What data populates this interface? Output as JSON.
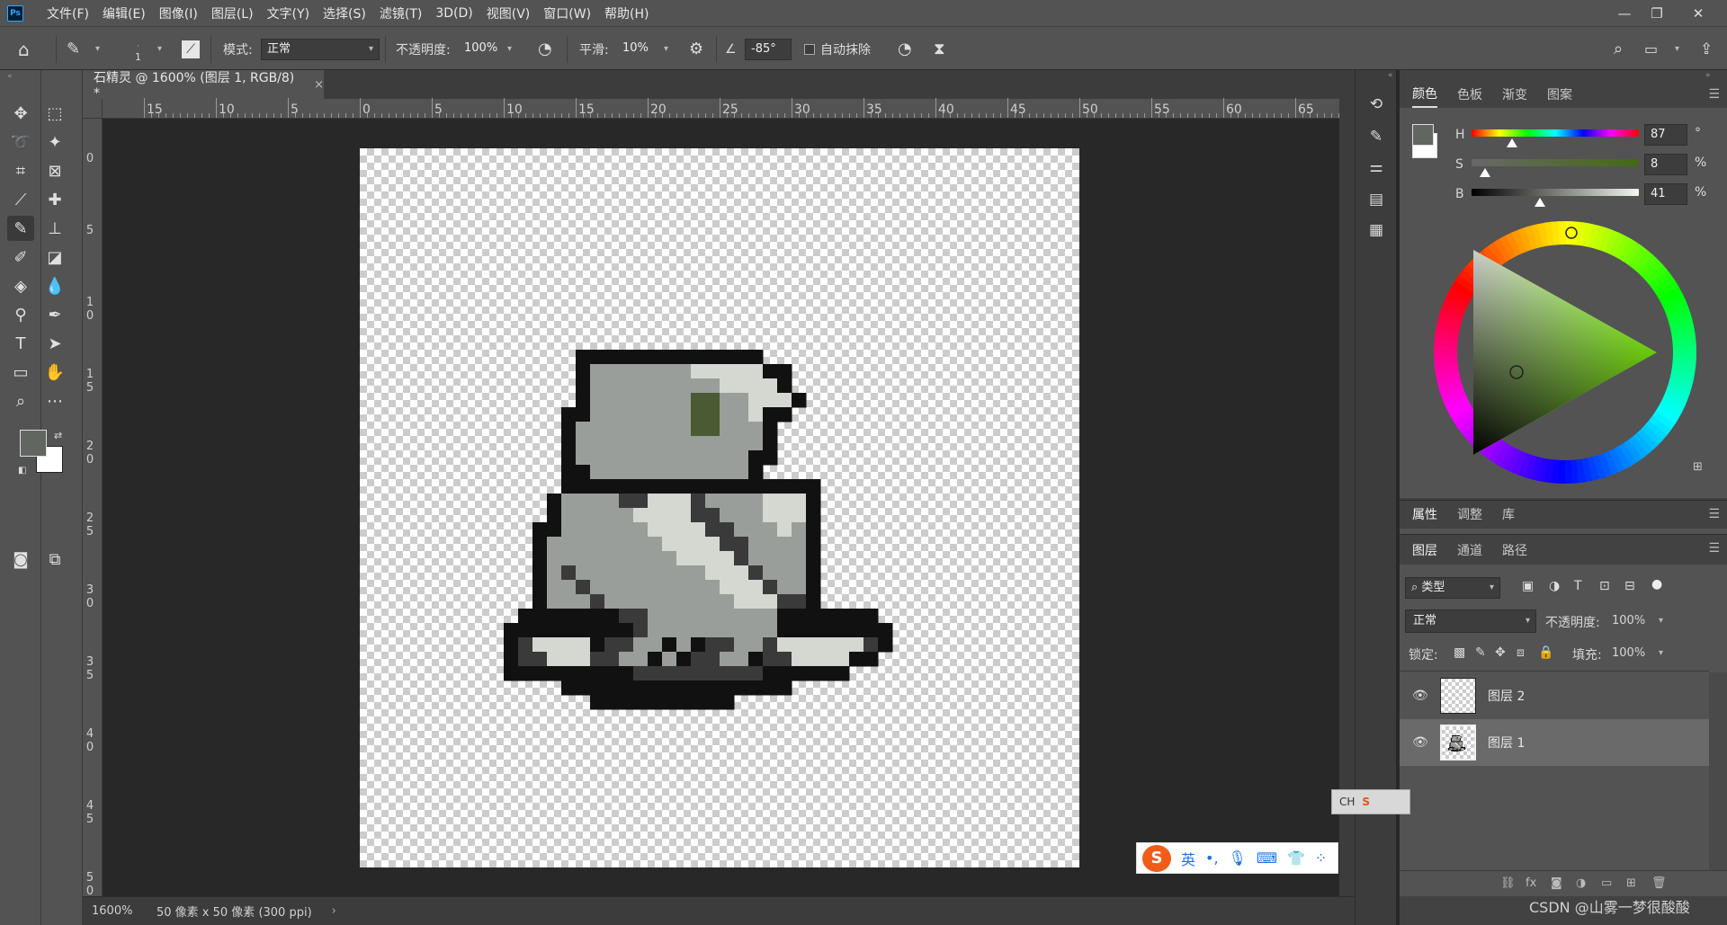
{
  "app": {
    "logo": "Ps"
  },
  "menu": [
    "文件(F)",
    "编辑(E)",
    "图像(I)",
    "图层(L)",
    "文字(Y)",
    "选择(S)",
    "滤镜(T)",
    "3D(D)",
    "视图(V)",
    "窗口(W)",
    "帮助(H)"
  ],
  "window_controls": {
    "minimize": "—",
    "restore": "❐",
    "close": "✕"
  },
  "options": {
    "brush_size": "1",
    "mode_label": "模式:",
    "mode_value": "正常",
    "opacity_label": "不透明度:",
    "opacity_value": "100%",
    "smoothing_label": "平滑:",
    "smoothing_value": "10%",
    "angle_value": "-85°",
    "auto_erase_label": "自动抹除"
  },
  "document": {
    "tab_title": "石精灵 @ 1600% (图层 1, RGB/8) *",
    "close_glyph": "×"
  },
  "ruler_top_labels": [
    "15",
    "10",
    "5",
    "0",
    "5",
    "10",
    "15",
    "20",
    "25",
    "30",
    "35",
    "40",
    "45",
    "50",
    "55",
    "60",
    "65"
  ],
  "ruler_left_labels": [
    "0",
    "5",
    "1\n0",
    "1\n5",
    "2\n0",
    "2\n5",
    "3\n0",
    "3\n5",
    "4\n0",
    "4\n5",
    "5\n0"
  ],
  "status": {
    "zoom": "1600%",
    "doc_info": "50 像素 x 50 像素 (300 ppi)",
    "arrow": "›"
  },
  "color_panel": {
    "tabs": [
      "颜色",
      "色板",
      "渐变",
      "图案"
    ],
    "h_label": "H",
    "h_value": "87",
    "h_unit": "°",
    "s_label": "S",
    "s_value": "8",
    "s_unit": "%",
    "b_label": "B",
    "b_value": "41",
    "b_unit": "%",
    "hue": 87,
    "saturation": 8,
    "brightness": 41,
    "foreground": "#626660",
    "background": "#ffffff"
  },
  "properties_panel": {
    "tabs": [
      "属性",
      "调整",
      "库"
    ]
  },
  "layers_panel": {
    "tabs": [
      "图层",
      "通道",
      "路径"
    ],
    "filter_label": "类型",
    "blend_mode": "正常",
    "opacity_label": "不透明度:",
    "opacity_value": "100%",
    "lock_label": "锁定:",
    "fill_label": "填充:",
    "fill_value": "100%",
    "layers": [
      {
        "name": "图层 2",
        "selected": false
      },
      {
        "name": "图层 1",
        "selected": true
      }
    ]
  },
  "ime": {
    "brand": "S",
    "lang": "英",
    "punct": "•,",
    "small_label": "CH"
  },
  "watermark": "CSDN @山雾一梦很酸酸"
}
